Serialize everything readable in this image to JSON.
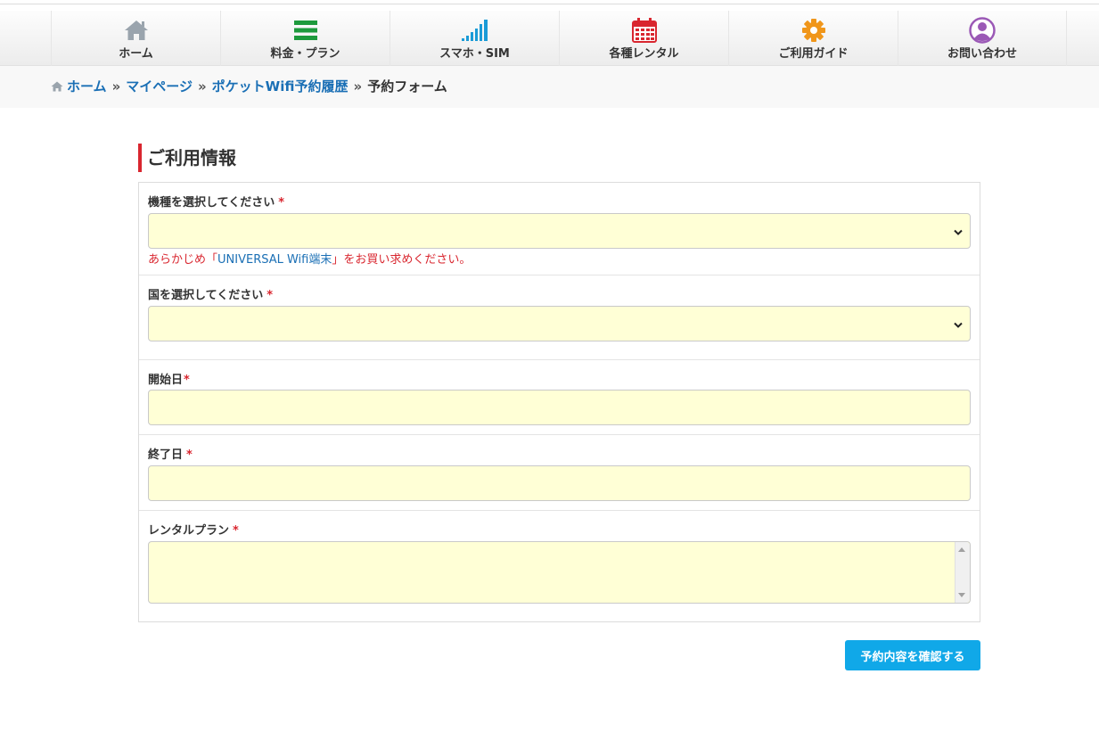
{
  "nav": {
    "items": [
      {
        "label": "ホーム",
        "icon": "house-icon"
      },
      {
        "label": "料金・プラン",
        "icon": "list-icon"
      },
      {
        "label": "スマホ・SIM",
        "icon": "signal-icon"
      },
      {
        "label": "各種レンタル",
        "icon": "calendar-icon"
      },
      {
        "label": "ご利用ガイド",
        "icon": "gear-icon"
      },
      {
        "label": "お問い合わせ",
        "icon": "user-icon"
      }
    ]
  },
  "breadcrumb": {
    "home": "ホーム",
    "mypage": "マイページ",
    "history": "ポケットWifi予約履歴",
    "current": "予約フォーム",
    "separator": "»"
  },
  "section": {
    "title": "ご利用情報"
  },
  "form": {
    "required_mark": "*",
    "device": {
      "label": "機種を選択してください",
      "value": "",
      "note_prefix": "あらかじめ「",
      "note_link": "UNIVERSAL Wifi端末",
      "note_suffix": "」をお買い求めください。"
    },
    "country": {
      "label": "国を選択してください",
      "value": ""
    },
    "start_date": {
      "label": "開始日",
      "value": ""
    },
    "end_date": {
      "label": "終了日",
      "value": ""
    },
    "rental_plan": {
      "label": "レンタルプラン",
      "value": ""
    }
  },
  "submit": {
    "label": "予約内容を確認する"
  },
  "colors": {
    "accent_red": "#d9262f",
    "link_blue": "#1a6fb5",
    "button_blue": "#10a8e8",
    "field_bg": "#ffffd6"
  }
}
